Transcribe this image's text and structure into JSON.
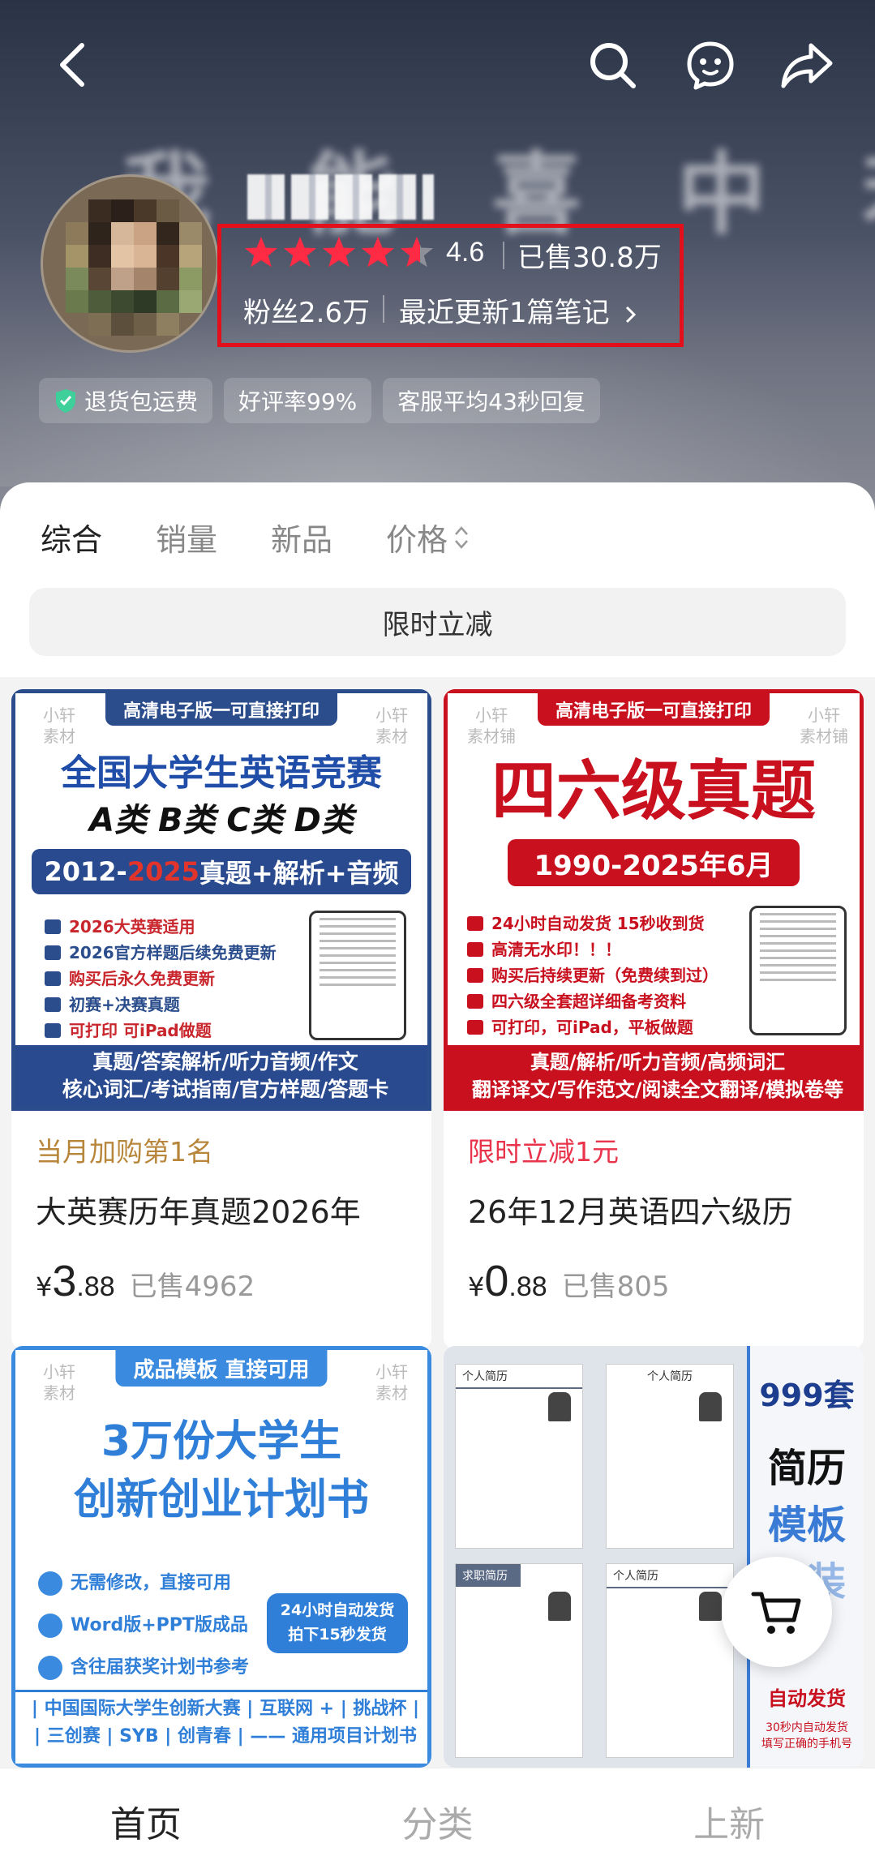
{
  "header": {
    "banner_text": "",
    "shop_name": "",
    "rating": "4.6",
    "sold": "已售30.8万",
    "fans": "粉丝2.6万",
    "recent_update": "最近更新1篇笔记",
    "stars": 4.6,
    "colors": {
      "star": "#ff2a44",
      "highlight_box": "#e3101c"
    }
  },
  "tags": [
    {
      "label": "退货包运费",
      "icon": "shield-check-icon"
    },
    {
      "label": "好评率99%"
    },
    {
      "label": "客服平均43秒回复"
    }
  ],
  "sort": {
    "tabs": [
      "综合",
      "销量",
      "新品",
      "价格"
    ],
    "active": "综合"
  },
  "promo_button": "限时立减",
  "products": [
    {
      "thumb": {
        "ribbon": "高清电子版一可直接打印",
        "wm_left": "小轩\n素材",
        "wm_right": "小轩\n素材",
        "headline": "全国大学生英语竞赛",
        "sub": "A类 B类 C类 D类",
        "band_prefix": "2012-",
        "band_year": "2025",
        "band_suffix": "真题+解析+音频",
        "bullets": [
          "2026大英赛适用",
          "2026官方样题后续免费更新",
          "购买后永久免费更新",
          "初赛+决赛真题",
          "可打印 可iPad做题"
        ],
        "footer1": "真题/答案解析/听力音频/作文",
        "footer2": "核心词汇/考试指南/官方样题/答题卡"
      },
      "tag": "当月加购第1名",
      "tag_color": "#b8863b",
      "title": "大英赛历年真题2026年",
      "price_currency": "¥",
      "price_int": "3",
      "price_dec": ".88",
      "sold": "已售4962"
    },
    {
      "thumb": {
        "ribbon": "高清电子版一可直接打印",
        "wm_left": "小轩\n素材铺",
        "wm_right": "小轩\n素材铺",
        "headline": "四六级真题",
        "band": "1990-2025年6月",
        "bullets": [
          "24小时自动发货 15秒收到货",
          "高清无水印！！！",
          "购买后持续更新（免费续到过）",
          "四六级全套超详细备考资料",
          "可打印，可iPad，平板做题"
        ],
        "footer1": "真题/解析/听力音频/高频词汇",
        "footer2": "翻译译文/写作范文/阅读全文翻译/模拟卷等"
      },
      "tag": "限时立减1元",
      "tag_color": "#e8334a",
      "title": "26年12月英语四六级历",
      "price_currency": "¥",
      "price_int": "0",
      "price_dec": ".88",
      "sold": "已售805"
    },
    {
      "thumb": {
        "ribbon": "成品模板 直接可用",
        "wm_left": "小轩\n素材",
        "wm_right": "小轩\n素材",
        "headline1": "3万份大学生",
        "headline2": "创新创业计划书",
        "bullets": [
          "无需修改，直接可用",
          "Word版+PPT版成品",
          "含往届获奖计划书参考"
        ],
        "badge1": "24小时自动发货",
        "badge2": "拍下15秒发货",
        "footer1": "| 中国国际大学生创新大赛 | 互联网 + | 挑战杯 |",
        "footer2": "| 三创赛 | SYB | 创青春 | —— 通用项目计划书"
      }
    },
    {
      "thumb": {
        "count": "999套",
        "line1": "简历",
        "line2": "模板",
        "line3": "套装",
        "auto": "自动发货",
        "small1": "30秒内自动发货",
        "small2": "填写正确的手机号",
        "resume_titles": [
          "个人简历",
          "个人简历",
          "求职简历",
          "个人简历"
        ]
      }
    }
  ],
  "bottom_nav": [
    "首页",
    "分类",
    "上新"
  ],
  "bottom_nav_active": "首页"
}
